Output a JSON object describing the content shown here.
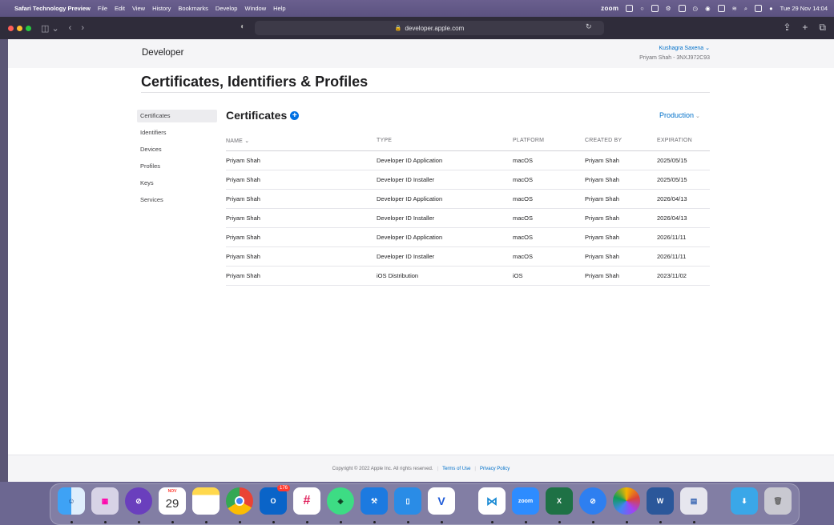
{
  "menubar": {
    "app_name": "Safari Technology Preview",
    "menus": [
      "File",
      "Edit",
      "View",
      "History",
      "Bookmarks",
      "Develop",
      "Window",
      "Help"
    ],
    "zoom_label": "zoom",
    "clock": "Tue 29 Nov 14:04"
  },
  "browser": {
    "url": "developer.apple.com"
  },
  "header": {
    "logo_text": "Developer",
    "account_name": "Kushagra Saxena",
    "team": "Priyam Shah - 3NXJ972C93"
  },
  "page": {
    "title": "Certificates, Identifiers & Profiles"
  },
  "sidebar": {
    "items": [
      {
        "label": "Certificates",
        "active": true
      },
      {
        "label": "Identifiers"
      },
      {
        "label": "Devices"
      },
      {
        "label": "Profiles"
      },
      {
        "label": "Keys"
      },
      {
        "label": "Services"
      }
    ]
  },
  "certificates": {
    "section_title": "Certificates",
    "environment": "Production",
    "columns": [
      "NAME",
      "TYPE",
      "PLATFORM",
      "CREATED BY",
      "EXPIRATION"
    ],
    "rows": [
      [
        "Priyam Shah",
        "Developer ID Application",
        "macOS",
        "Priyam Shah",
        "2025/05/15"
      ],
      [
        "Priyam Shah",
        "Developer ID Installer",
        "macOS",
        "Priyam Shah",
        "2025/05/15"
      ],
      [
        "Priyam Shah",
        "Developer ID Application",
        "macOS",
        "Priyam Shah",
        "2026/04/13"
      ],
      [
        "Priyam Shah",
        "Developer ID Installer",
        "macOS",
        "Priyam Shah",
        "2026/04/13"
      ],
      [
        "Priyam Shah",
        "Developer ID Application",
        "macOS",
        "Priyam Shah",
        "2026/11/11"
      ],
      [
        "Priyam Shah",
        "Developer ID Installer",
        "macOS",
        "Priyam Shah",
        "2026/11/11"
      ],
      [
        "Priyam Shah",
        "iOS Distribution",
        "iOS",
        "Priyam Shah",
        "2023/11/02"
      ]
    ]
  },
  "footer": {
    "copyright": "Copyright © 2022 Apple Inc. All rights reserved.",
    "terms": "Terms of Use",
    "privacy": "Privacy Policy"
  },
  "dock": {
    "calendar_month": "NOV",
    "calendar_day": "29",
    "outlook_badge": "176",
    "zoom_label": "zoom",
    "apps": [
      "finder-icon",
      "launchpad-icon",
      "safari-preview-icon",
      "calendar-icon",
      "notes-icon",
      "chrome-icon",
      "outlook-icon",
      "slack-icon",
      "android-studio-icon",
      "xcode-icon",
      "simulator-icon",
      "vysor-icon",
      "vscode-icon",
      "zoom-icon",
      "excel-icon",
      "safari-icon",
      "photos-icon",
      "word-icon",
      "preview-icon",
      "downloads-folder-icon",
      "trash-icon"
    ]
  }
}
